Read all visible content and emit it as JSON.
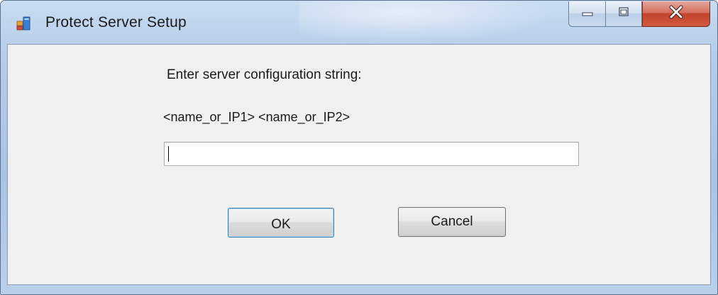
{
  "window": {
    "title": "Protect Server Setup"
  },
  "caption_buttons": {
    "minimize_icon": "minimize-icon",
    "maximize_icon": "maximize-icon",
    "close_icon": "close-icon"
  },
  "dialog": {
    "prompt": "Enter server configuration string:",
    "format_hint": "<name_or_IP1> <name_or_IP2>",
    "input_value": "",
    "ok_label": "OK",
    "cancel_label": "Cancel"
  },
  "colors": {
    "dialog_background": "#f0f0f0",
    "close_button": "#c2422b",
    "titlebar": "#b6cde8"
  }
}
